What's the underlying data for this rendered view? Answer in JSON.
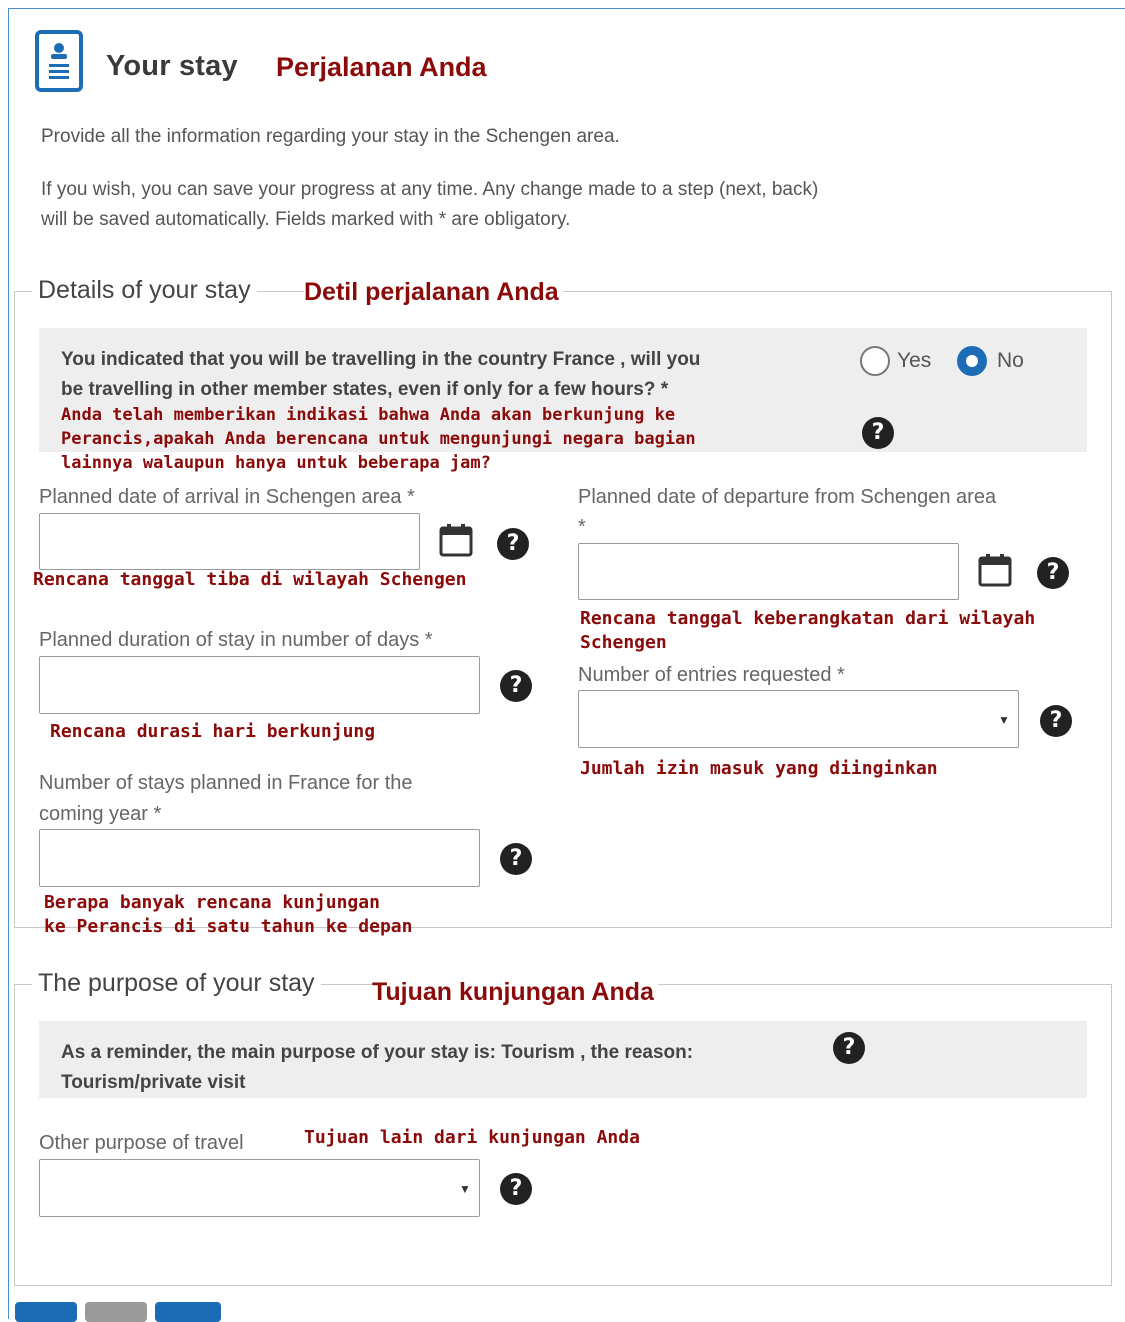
{
  "header": {
    "title": "Your stay",
    "title_translation": "Perjalanan Anda"
  },
  "intro": {
    "line1": "Provide all the information regarding your stay in the Schengen area.",
    "line2a": "If you wish, you can save your progress at any time. Any change made to a step (next, back)",
    "line2b": "will be saved automatically. Fields marked with * are obligatory."
  },
  "details": {
    "legend": "Details of your stay",
    "legend_translation": "Detil perjalanan Anda",
    "question": {
      "line1": "You indicated that you will be travelling in the country France , will you",
      "line2": "be travelling in other member states, even if only for a few hours? *",
      "tr1": "Anda telah memberikan indikasi bahwa Anda akan berkunjung ke",
      "tr2": "Perancis,apakah Anda berencana untuk mengunjungi negara bagian",
      "tr3": "lainnya walaupun hanya untuk beberapa jam?",
      "yes_label": "Yes",
      "no_label": "No",
      "selected": "No"
    },
    "arrival": {
      "label": "Planned date of arrival in Schengen area *",
      "value": "",
      "translation": "Rencana tanggal tiba di wilayah Schengen"
    },
    "departure": {
      "label": "Planned date of departure from Schengen area",
      "asterisk": "*",
      "value": "",
      "translation1": "Rencana tanggal keberangkatan dari wilayah",
      "translation2": "Schengen"
    },
    "duration": {
      "label": "Planned duration of stay in number of days *",
      "value": "",
      "translation": "Rencana durasi hari berkunjung"
    },
    "entries": {
      "label": "Number of entries requested *",
      "value": "",
      "translation": "Jumlah izin masuk yang diinginkan"
    },
    "stays": {
      "label1": "Number of stays planned in France for the",
      "label2": "coming year *",
      "value": "",
      "translation1": "Berapa banyak rencana kunjungan",
      "translation2": "ke Perancis di satu tahun ke depan"
    }
  },
  "purpose": {
    "legend": "The purpose of your stay",
    "legend_translation": "Tujuan kunjungan Anda",
    "reminder_line1": "As a reminder, the main purpose of your stay is: Tourism , the reason:",
    "reminder_line2": "Tourism/private visit",
    "other": {
      "label": "Other purpose of travel",
      "translation": "Tujuan lain dari kunjungan Anda",
      "value": ""
    }
  },
  "icons": {
    "help": "?",
    "caret": "▼"
  },
  "colors": {
    "accent": "#1c6db5",
    "translation_red": "#8b0a0a",
    "panel_grey": "#eeeeee"
  }
}
